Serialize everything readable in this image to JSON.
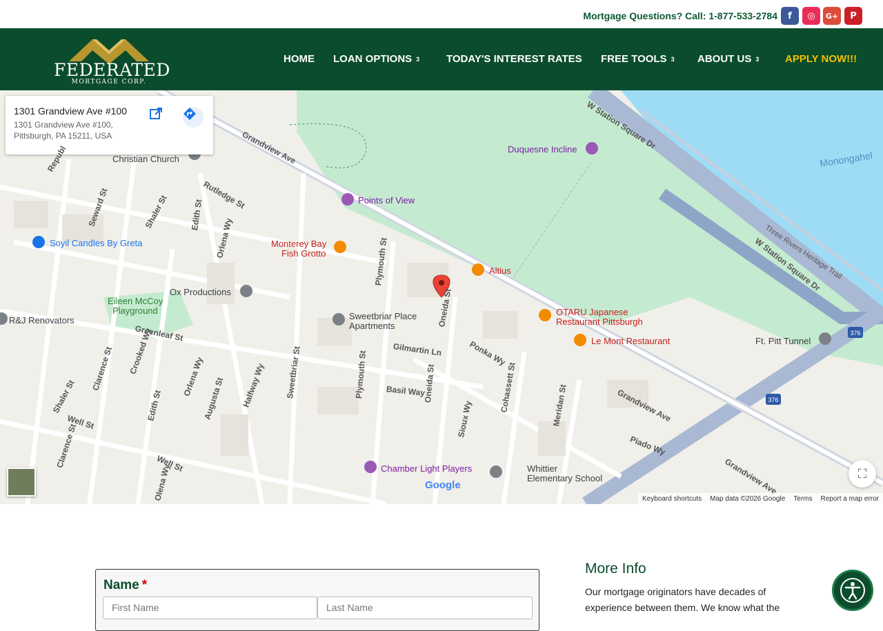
{
  "topbar": {
    "text": "Mortgage Questions? Call: 1-877-533-2784",
    "social": [
      {
        "icon": "facebook-icon",
        "glyph": "f",
        "color": "#3b5998"
      },
      {
        "icon": "instagram-icon",
        "glyph": "◎",
        "color": "#ea2c59"
      },
      {
        "icon": "google-plus-icon",
        "glyph": "G+",
        "color": "#dd4b39"
      },
      {
        "icon": "pinterest-icon",
        "glyph": "P",
        "color": "#cb2027"
      }
    ]
  },
  "logo": {
    "word": "FEDERATED",
    "sub": "MORTGAGE CORP."
  },
  "nav": {
    "home": "HOME",
    "loan": "LOAN OPTIONS",
    "rates": "TODAY'S INTEREST RATES",
    "tools": "FREE TOOLS",
    "about": "ABOUT US",
    "apply": "APPLY NOW!!!",
    "chevron": "3",
    "colors": {
      "bar": "#0b4c2c",
      "accent": "#f2c200"
    }
  },
  "map": {
    "card": {
      "title": "1301 Grandview Ave #100",
      "address": "1301 Grandview Ave #100, Pittsburgh, PA 15211, USA"
    },
    "pois": {
      "duquesne": "Duquesne Incline",
      "points": "Points of View",
      "soyil": "Soyil Candles By Greta",
      "monterey1": "Monterey Bay",
      "monterey2": "Fish Grotto",
      "altius": "Altius",
      "ox": "Ox Productions",
      "eileen1": "Eileen McCoy",
      "eileen2": "Playground",
      "sweetbriar1": "Sweetbriar Place",
      "sweetbriar2": "Apartments",
      "otaru1": "OTARU Japanese",
      "otaru2": "Restaurant Pittsburgh",
      "lemont": "Le Mont Restaurant",
      "ftpitt": "Ft. Pitt Tunnel",
      "rj": "R&J Renovators",
      "chamber": "Chamber Light Players",
      "whittier1": "Whittier",
      "whittier2": "Elementary School",
      "christian": "Christian Church",
      "river": "Monongahel"
    },
    "streets": {
      "station": "W Station Square Dr",
      "station2": "W Station Square Dr",
      "grandview": "Grandview Ave",
      "grandview2": "Grandview Ave",
      "grandview3": "Grandview Ave",
      "rutledge": "Rutledge St",
      "seward": "Seward St",
      "shaler": "Shaler St",
      "shaler2": "Shaler St",
      "edith": "Edith St",
      "edith2": "Edith St",
      "orlena": "Orlena Wy",
      "orlena2": "Orlena Wy",
      "orlena3": "Olena Wy",
      "plymouth": "Plymouth St",
      "plymouth2": "Plymouth St",
      "oneida": "Oneida St",
      "oneida2": "Oneida St",
      "ponka": "Ponka Wy",
      "gilmartin": "Gilmartin Ln",
      "greenleaf": "Greenleaf St",
      "clarence": "Clarence St",
      "clarence2": "Clarence St",
      "crooked": "Crooked Wy",
      "augusta": "Augusta St",
      "halfway": "Halfway Wy",
      "sweetbriar": "Sweetbriar St",
      "basil": "Basil Way",
      "sioux": "Sioux Wy",
      "cohassett": "Cohassett St",
      "meridan": "Meridan St",
      "piado": "Piado Wy",
      "well": "Well St",
      "well2": "Well St",
      "trail": "Three Rivers Heritage Trail",
      "repub": "Republ"
    },
    "shields": {
      "i376a": "376",
      "i376b": "376"
    },
    "footer": {
      "keyboard": "Keyboard shortcuts",
      "data": "Map data ©2026 Google",
      "terms": "Terms",
      "report": "Report a map error"
    },
    "google": "Google"
  },
  "form": {
    "name_label": "Name",
    "required": "*",
    "first_placeholder": "First Name",
    "last_placeholder": "Last Name"
  },
  "more": {
    "title": "More Info",
    "body": "Our mortgage originators have decades of experience between them. We know what the"
  }
}
